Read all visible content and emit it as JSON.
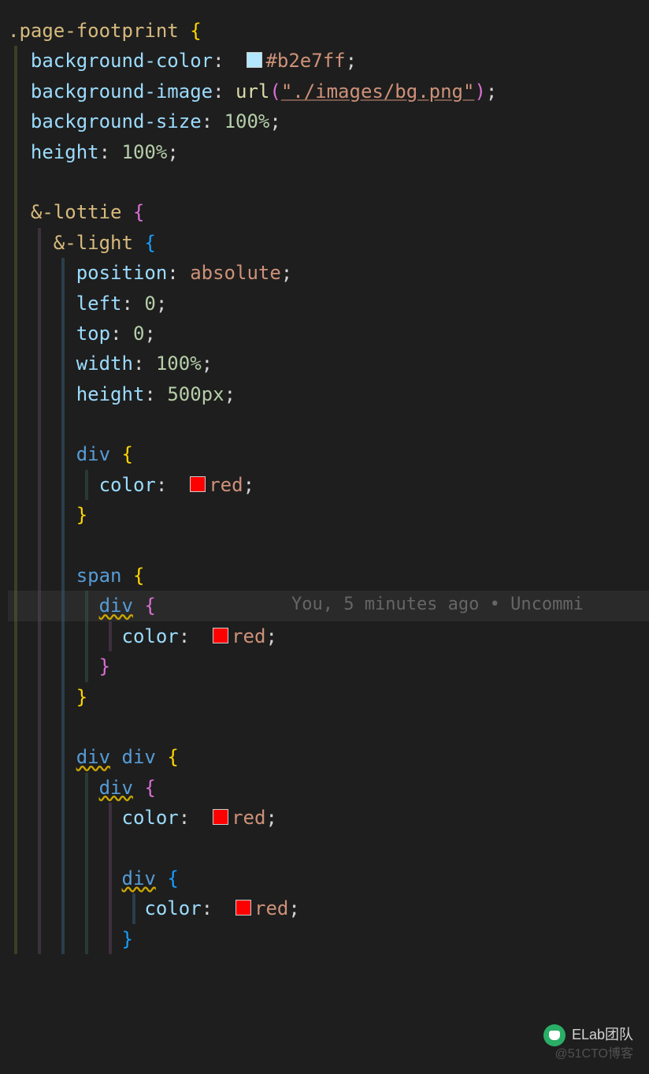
{
  "code": {
    "lines": [
      {
        "indent": 0,
        "tokens": [
          {
            "t": "selector",
            "v": ".page-footprint"
          },
          {
            "t": "space",
            "v": " "
          },
          {
            "t": "brace-yellow",
            "v": "{"
          }
        ]
      },
      {
        "indent": 1,
        "tokens": [
          {
            "t": "property",
            "v": "background-color"
          },
          {
            "t": "colon",
            "v": ":"
          },
          {
            "t": "space",
            "v": "  "
          },
          {
            "t": "swatch",
            "color": "#b2e7ff"
          },
          {
            "t": "value",
            "v": "#b2e7ff"
          },
          {
            "t": "semi",
            "v": ";"
          }
        ]
      },
      {
        "indent": 1,
        "tokens": [
          {
            "t": "property",
            "v": "background-image"
          },
          {
            "t": "colon",
            "v": ":"
          },
          {
            "t": "space",
            "v": " "
          },
          {
            "t": "func",
            "v": "url"
          },
          {
            "t": "paren",
            "v": "("
          },
          {
            "t": "string",
            "v": "\"./images/bg.png\""
          },
          {
            "t": "paren",
            "v": ")"
          },
          {
            "t": "semi",
            "v": ";"
          }
        ]
      },
      {
        "indent": 1,
        "tokens": [
          {
            "t": "property",
            "v": "background-size"
          },
          {
            "t": "colon",
            "v": ":"
          },
          {
            "t": "space",
            "v": " "
          },
          {
            "t": "number",
            "v": "100%"
          },
          {
            "t": "semi",
            "v": ";"
          }
        ]
      },
      {
        "indent": 1,
        "tokens": [
          {
            "t": "property",
            "v": "height"
          },
          {
            "t": "colon",
            "v": ":"
          },
          {
            "t": "space",
            "v": " "
          },
          {
            "t": "number",
            "v": "100%"
          },
          {
            "t": "semi",
            "v": ";"
          }
        ]
      },
      {
        "indent": 1,
        "tokens": []
      },
      {
        "indent": 1,
        "tokens": [
          {
            "t": "amp",
            "v": "&-lottie"
          },
          {
            "t": "space",
            "v": " "
          },
          {
            "t": "brace-purple",
            "v": "{"
          }
        ]
      },
      {
        "indent": 2,
        "tokens": [
          {
            "t": "amp",
            "v": "&-light"
          },
          {
            "t": "space",
            "v": " "
          },
          {
            "t": "brace-blue",
            "v": "{"
          }
        ]
      },
      {
        "indent": 3,
        "tokens": [
          {
            "t": "property",
            "v": "position"
          },
          {
            "t": "colon",
            "v": ":"
          },
          {
            "t": "space",
            "v": " "
          },
          {
            "t": "value",
            "v": "absolute"
          },
          {
            "t": "semi",
            "v": ";"
          }
        ]
      },
      {
        "indent": 3,
        "tokens": [
          {
            "t": "property",
            "v": "left"
          },
          {
            "t": "colon",
            "v": ":"
          },
          {
            "t": "space",
            "v": " "
          },
          {
            "t": "number",
            "v": "0"
          },
          {
            "t": "semi",
            "v": ";"
          }
        ]
      },
      {
        "indent": 3,
        "tokens": [
          {
            "t": "property",
            "v": "top"
          },
          {
            "t": "colon",
            "v": ":"
          },
          {
            "t": "space",
            "v": " "
          },
          {
            "t": "number",
            "v": "0"
          },
          {
            "t": "semi",
            "v": ";"
          }
        ]
      },
      {
        "indent": 3,
        "tokens": [
          {
            "t": "property",
            "v": "width"
          },
          {
            "t": "colon",
            "v": ":"
          },
          {
            "t": "space",
            "v": " "
          },
          {
            "t": "number",
            "v": "100%"
          },
          {
            "t": "semi",
            "v": ";"
          }
        ]
      },
      {
        "indent": 3,
        "tokens": [
          {
            "t": "property",
            "v": "height"
          },
          {
            "t": "colon",
            "v": ":"
          },
          {
            "t": "space",
            "v": " "
          },
          {
            "t": "number",
            "v": "500px"
          },
          {
            "t": "semi",
            "v": ";"
          }
        ]
      },
      {
        "indent": 3,
        "tokens": []
      },
      {
        "indent": 3,
        "tokens": [
          {
            "t": "tag",
            "v": "div"
          },
          {
            "t": "space",
            "v": " "
          },
          {
            "t": "brace-yellow",
            "v": "{"
          }
        ]
      },
      {
        "indent": 4,
        "tokens": [
          {
            "t": "property",
            "v": "color"
          },
          {
            "t": "colon",
            "v": ":"
          },
          {
            "t": "space",
            "v": "  "
          },
          {
            "t": "swatch",
            "color": "#ff0000"
          },
          {
            "t": "red-val",
            "v": "red"
          },
          {
            "t": "semi",
            "v": ";"
          }
        ]
      },
      {
        "indent": 3,
        "tokens": [
          {
            "t": "brace-yellow",
            "v": "}"
          }
        ]
      },
      {
        "indent": 3,
        "tokens": []
      },
      {
        "indent": 3,
        "tokens": [
          {
            "t": "tag",
            "v": "span"
          },
          {
            "t": "space",
            "v": " "
          },
          {
            "t": "brace-yellow",
            "v": "{"
          }
        ]
      },
      {
        "indent": 4,
        "highlight": true,
        "squiggle": true,
        "tokens": [
          {
            "t": "tag",
            "v": "div"
          },
          {
            "t": "space",
            "v": " "
          },
          {
            "t": "brace-purple",
            "v": "{"
          }
        ],
        "blame": "You, 5 minutes ago • Uncommi"
      },
      {
        "indent": 5,
        "tokens": [
          {
            "t": "property",
            "v": "color"
          },
          {
            "t": "colon",
            "v": ":"
          },
          {
            "t": "space",
            "v": "  "
          },
          {
            "t": "swatch",
            "color": "#ff0000"
          },
          {
            "t": "red-val",
            "v": "red"
          },
          {
            "t": "semi",
            "v": ";"
          }
        ]
      },
      {
        "indent": 4,
        "tokens": [
          {
            "t": "brace-purple",
            "v": "}"
          }
        ]
      },
      {
        "indent": 3,
        "tokens": [
          {
            "t": "brace-yellow",
            "v": "}"
          }
        ]
      },
      {
        "indent": 3,
        "tokens": []
      },
      {
        "indent": 3,
        "squiggle": true,
        "tokens": [
          {
            "t": "tag",
            "v": "div"
          },
          {
            "t": "space",
            "v": " "
          },
          {
            "t": "tag",
            "v": "div"
          },
          {
            "t": "space",
            "v": " "
          },
          {
            "t": "brace-yellow",
            "v": "{"
          }
        ]
      },
      {
        "indent": 4,
        "squiggle": true,
        "tokens": [
          {
            "t": "tag",
            "v": "div"
          },
          {
            "t": "space",
            "v": " "
          },
          {
            "t": "brace-purple",
            "v": "{"
          }
        ]
      },
      {
        "indent": 5,
        "tokens": [
          {
            "t": "property",
            "v": "color"
          },
          {
            "t": "colon",
            "v": ":"
          },
          {
            "t": "space",
            "v": "  "
          },
          {
            "t": "swatch",
            "color": "#ff0000"
          },
          {
            "t": "red-val",
            "v": "red"
          },
          {
            "t": "semi",
            "v": ";"
          }
        ]
      },
      {
        "indent": 5,
        "tokens": []
      },
      {
        "indent": 5,
        "squiggle": true,
        "tokens": [
          {
            "t": "tag",
            "v": "div"
          },
          {
            "t": "space",
            "v": " "
          },
          {
            "t": "brace-blue",
            "v": "{"
          }
        ]
      },
      {
        "indent": 6,
        "tokens": [
          {
            "t": "property",
            "v": "color"
          },
          {
            "t": "colon",
            "v": ":"
          },
          {
            "t": "space",
            "v": "  "
          },
          {
            "t": "swatch",
            "color": "#ff0000"
          },
          {
            "t": "red-val",
            "v": "red"
          },
          {
            "t": "semi",
            "v": ";"
          }
        ]
      },
      {
        "indent": 5,
        "tokens": [
          {
            "t": "brace-blue",
            "v": "}"
          }
        ]
      }
    ]
  },
  "blame_text": "You, 5 minutes ago • Uncommi",
  "watermark": "ELab团队",
  "watermark_sub": "@51CTO博客"
}
